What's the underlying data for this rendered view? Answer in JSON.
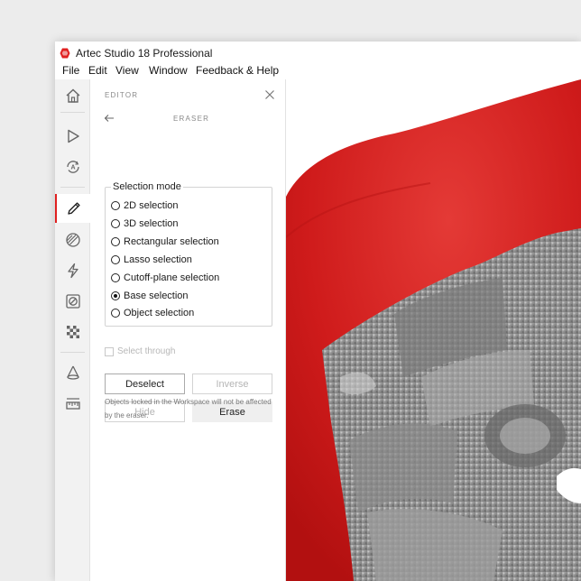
{
  "window": {
    "title": "Artec Studio 18 Professional"
  },
  "menu": {
    "items": [
      "File",
      "Edit",
      "View",
      "Window",
      "Feedback & Help"
    ]
  },
  "rail": {
    "icons": [
      "home-icon",
      "play-icon",
      "autopilot-icon",
      "pencil-icon",
      "scan-overlay-icon",
      "lightning-icon",
      "prohibited-icon",
      "checkerboard-icon",
      "cone-icon",
      "ruler-icon"
    ],
    "active": "pencil-icon"
  },
  "panel": {
    "title": "EDITOR",
    "subtitle": "ERASER",
    "selection_mode": {
      "legend": "Selection mode",
      "options": [
        "2D selection",
        "3D selection",
        "Rectangular selection",
        "Lasso selection",
        "Cutoff-plane selection",
        "Base selection",
        "Object selection"
      ],
      "selected": "Base selection"
    },
    "select_through": {
      "label": "Select through",
      "checked": false,
      "enabled": false
    },
    "buttons": {
      "deselect": "Deselect",
      "inverse": "Inverse",
      "hide": "Hide",
      "erase": "Erase"
    },
    "note": "Objects locked in the Workspace will not be affected by the eraser."
  },
  "colors": {
    "accent": "#e02020",
    "selection_red": "#d21a1a",
    "model_gray": "#9a9a9a"
  }
}
